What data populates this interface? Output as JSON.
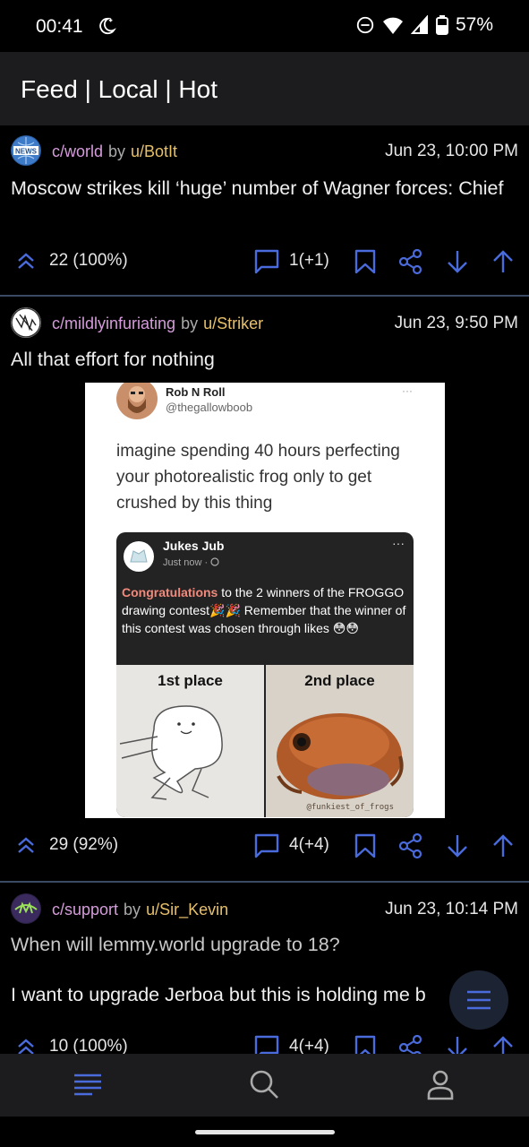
{
  "status_bar": {
    "time": "00:41",
    "battery": "57%"
  },
  "app_bar": {
    "title": "Feed | Local | Hot"
  },
  "posts": [
    {
      "community": "c/world",
      "by": "by",
      "user": "u/BotIt",
      "date": "Jun 23, 10:00 PM",
      "title": "Moscow strikes kill ‘huge’ number of Wagner forces: Chief",
      "score": "22 (100%)",
      "comments": "1(+1)"
    },
    {
      "community": "c/mildlyinfuriating",
      "by": "by",
      "user": "u/Striker",
      "date": "Jun 23, 9:50 PM",
      "title": "All that effort for nothing",
      "score": "29 (92%)",
      "comments": "4(+4)",
      "image": {
        "tweet_name": "Rob N Roll",
        "tweet_handle": "@thegallowboob",
        "tweet_dots": "···",
        "tweet_text": "imagine spending 40 hours perfecting your photorealistic frog only to get crushed by this thing",
        "fb_name": "Jukes Jub",
        "fb_time": "Just now ·",
        "fb_dots": "···",
        "fb_highlight": "Congratulations",
        "fb_text": " to the 2 winners of the FROGGO drawing contest🎉🎉 Remember that the winner of this contest was chosen through likes 😳😳",
        "first_place": "1st place",
        "second_place": "2nd place",
        "watermark": "@funkiest_of_frogs"
      }
    },
    {
      "community": "c/support",
      "by": "by",
      "user": "u/Sir_Kevin",
      "date": "Jun 23, 10:14 PM",
      "title": "When will lemmy.world upgrade to 18?",
      "body": "I want to upgrade Jerboa but this is holding me b",
      "score": "10 (100%)",
      "comments": "4(+4)"
    }
  ],
  "colors": {
    "accent": "#4a6bdc",
    "community": "#d59cdb",
    "user": "#e7c06a",
    "background": "#000000",
    "bar": "#1c1c1e"
  },
  "icons": [
    "do-not-disturb-moon-icon",
    "dnd-icon",
    "wifi-icon",
    "signal-icon",
    "battery-icon",
    "upvote-chevron-icon",
    "comment-icon",
    "bookmark-icon",
    "share-icon",
    "downvote-icon",
    "upvote-icon",
    "menu-icon",
    "search-icon",
    "profile-icon"
  ]
}
